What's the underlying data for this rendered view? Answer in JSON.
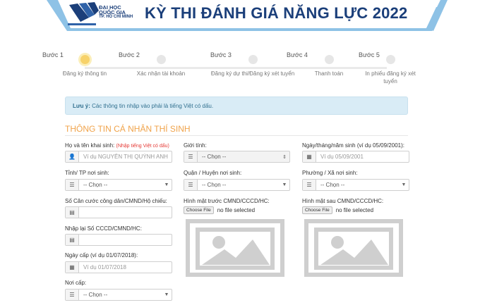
{
  "header": {
    "logo_line1": "ĐẠI HỌC",
    "logo_line2": "QUỐC GIA",
    "logo_line3": "TP. HỒ CHÍ MINH",
    "title": "KỲ THI ĐÁNH GIÁ NĂNG LỰC 2022",
    "colors": {
      "brand": "#1b3f7a",
      "band": "#8ec2e6"
    }
  },
  "stepper": {
    "active_index": 0,
    "steps": [
      {
        "label": "Bước 1",
        "desc": "Đăng ký thông tin"
      },
      {
        "label": "Bước 2",
        "desc": "Xác nhận tài khoản"
      },
      {
        "label": "Bước 3",
        "desc": "Đăng ký dự thi/Đăng ký xét tuyển"
      },
      {
        "label": "Bước 4",
        "desc": "Thanh toán"
      },
      {
        "label": "Bước 5",
        "desc": "In phiếu đăng ký xét tuyển"
      }
    ]
  },
  "alert": {
    "strong": "Lưu ý:",
    "text": " Các thông tin nhập vào phải là tiếng Việt có dấu."
  },
  "section": {
    "title": "THÔNG TIN CÁ NHÂN THÍ SINH"
  },
  "form": {
    "fullname": {
      "label": "Họ và tên khai sinh:",
      "hint": "(Nhập tiếng Việt có dấu)",
      "placeholder": "Ví dụ NGUYỄN THỊ QUỲNH ANH"
    },
    "gender": {
      "label": "Giới tính:",
      "value": "-- Chọn --"
    },
    "dob": {
      "label": "Ngày/tháng/năm sinh (ví dụ 05/09/2001):",
      "placeholder": "Ví dụ 05/09/2001"
    },
    "province": {
      "label": "Tỉnh/ TP nơi sinh:",
      "value": "-- Chọn --"
    },
    "district": {
      "label": "Quận / Huyện nơi sinh:",
      "value": "-- Chọn --"
    },
    "ward": {
      "label": "Phường / Xã nơi sinh:",
      "value": "-- Chọn --"
    },
    "id_number": {
      "label": "Số Căn cước công dân/CMND/Hộ chiếu:"
    },
    "id_front": {
      "label": "Hình mặt trước CMND/CCCD/HC:",
      "button": "Choose File",
      "status": "no file selected"
    },
    "id_back": {
      "label": "Hình mặt sau CMND/CCCD/HC:",
      "button": "Choose File",
      "status": "no file selected"
    },
    "id_confirm": {
      "label": "Nhập lại Số CCCD/CMND/HC:"
    },
    "issue_date": {
      "label": "Ngày cấp (ví dụ 01/07/2018):",
      "placeholder": "Ví dụ 01/07/2018"
    },
    "issue_place": {
      "label": "Nơi cấp:",
      "value": "-- Chọn --"
    }
  }
}
